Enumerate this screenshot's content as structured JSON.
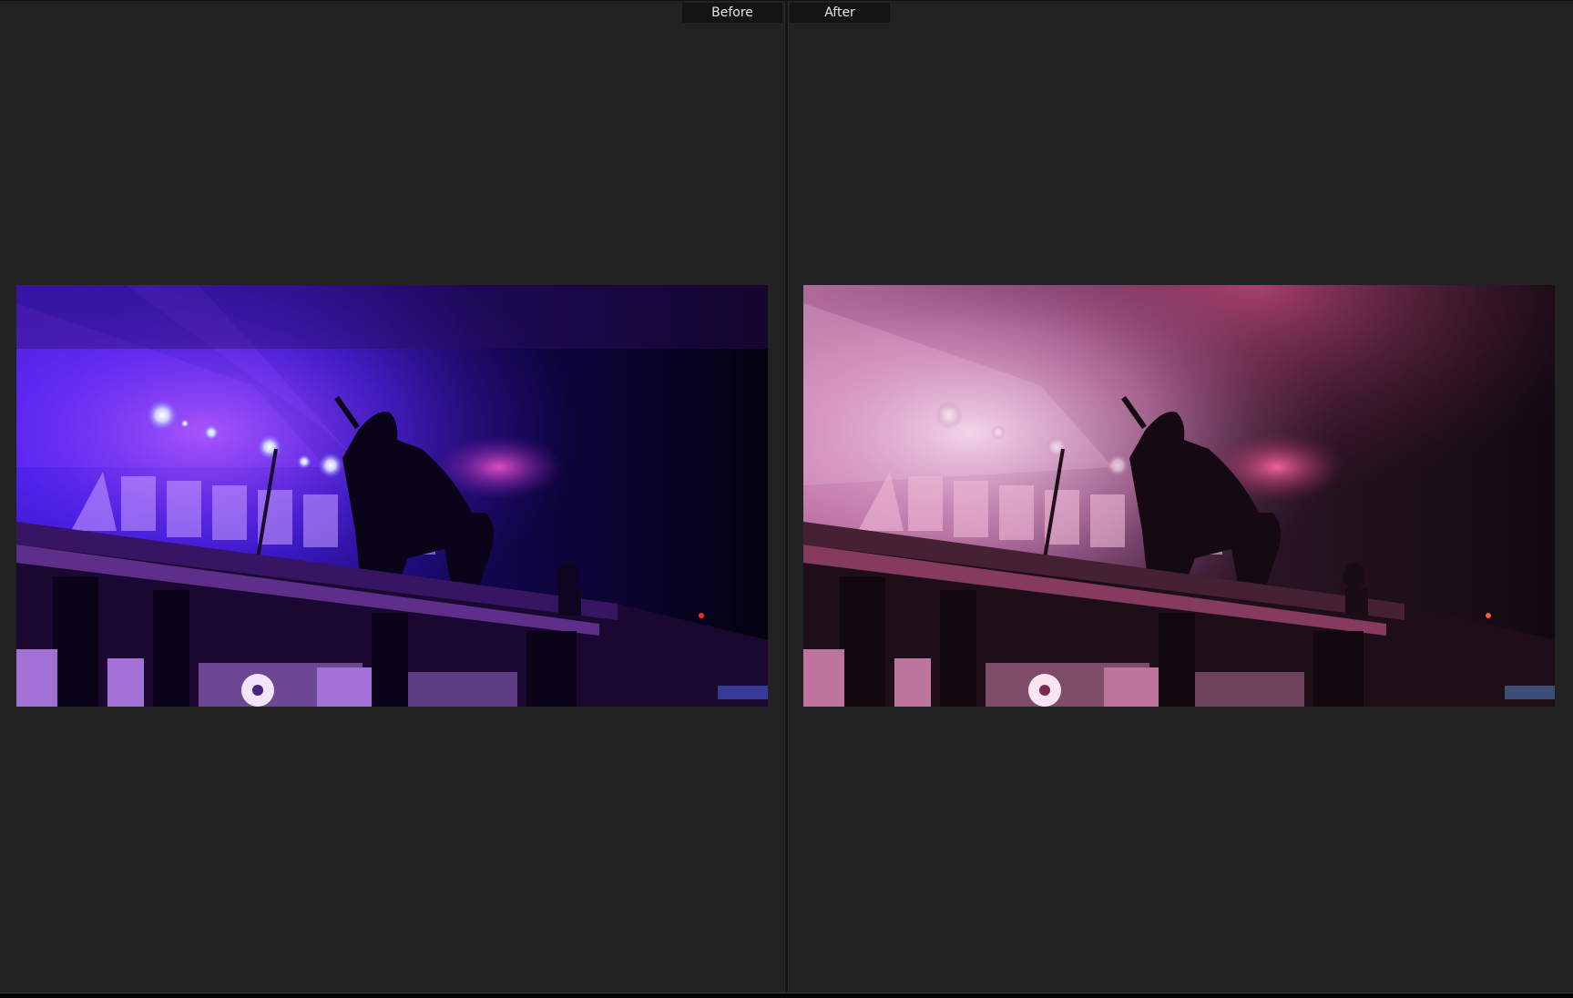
{
  "comparison": {
    "before_label": "Before",
    "after_label": "After"
  },
  "photos": {
    "before": {
      "icon": "concert-photo-before",
      "palette": {
        "base": "#0a0420",
        "light": "#3b1cff",
        "accent": "#a23cff",
        "glow": "#ffffff"
      }
    },
    "after": {
      "icon": "concert-photo-after",
      "palette": {
        "base": "#1a0d16",
        "light": "#e48bc4",
        "accent": "#ff4f94",
        "glow": "#f3dff0"
      }
    }
  }
}
